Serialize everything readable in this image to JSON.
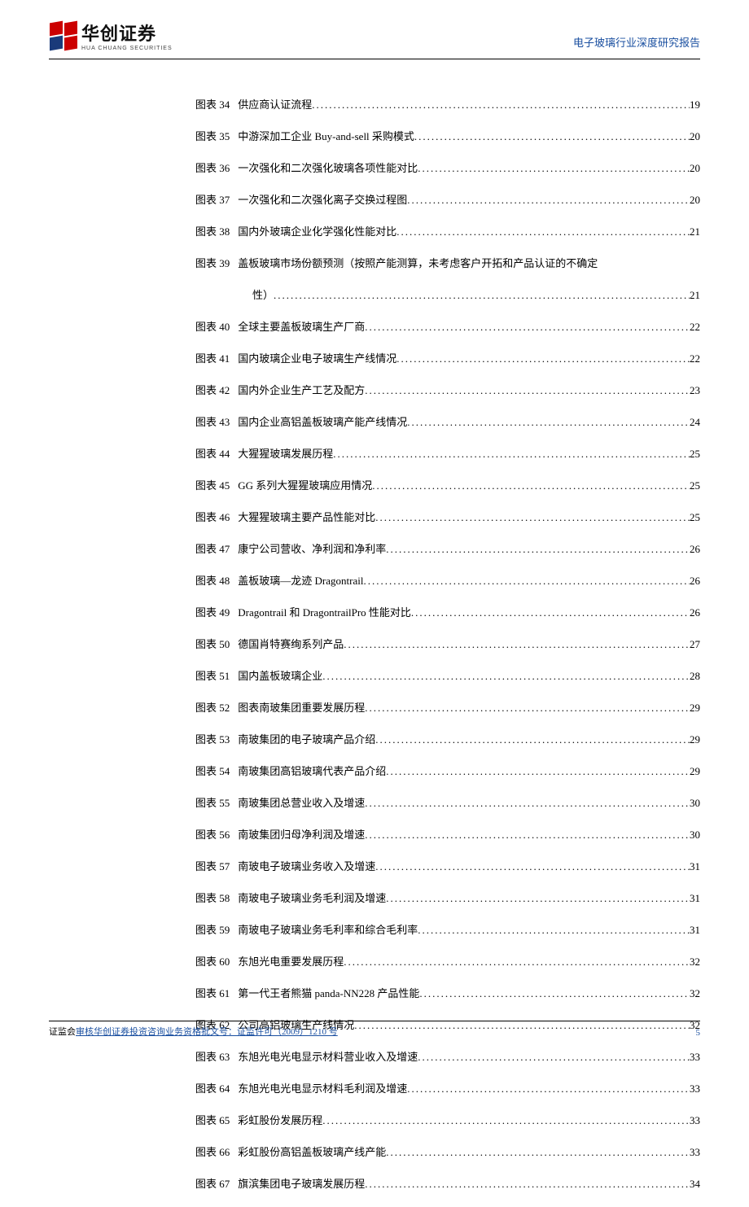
{
  "header": {
    "logo_cn": "华创证券",
    "logo_en": "HUA CHUANG SECURITIES",
    "report_title": "电子玻璃行业深度研究报告"
  },
  "toc": {
    "label_prefix": "图表",
    "entries": [
      {
        "num": "34",
        "title": "供应商认证流程",
        "page": "19"
      },
      {
        "num": "35",
        "title": "中游深加工企业 Buy-and-sell 采购模式",
        "page": "20"
      },
      {
        "num": "36",
        "title": "一次强化和二次强化玻璃各项性能对比",
        "page": "20"
      },
      {
        "num": "37",
        "title": "一次强化和二次强化离子交换过程图",
        "page": "20"
      },
      {
        "num": "38",
        "title": "国内外玻璃企业化学强化性能对比",
        "page": "21"
      },
      {
        "num": "39",
        "title": "盖板玻璃市场份额预测（按照产能测算，未考虑客户开拓和产品认证的不确定",
        "wrap": "性）",
        "page": "21"
      },
      {
        "num": "40",
        "title": "全球主要盖板玻璃生产厂商",
        "page": "22"
      },
      {
        "num": "41",
        "title": "国内玻璃企业电子玻璃生产线情况",
        "page": "22"
      },
      {
        "num": "42",
        "title": "国内外企业生产工艺及配方",
        "page": "23"
      },
      {
        "num": "43",
        "title": "国内企业高铝盖板玻璃产能产线情况",
        "page": "24"
      },
      {
        "num": "44",
        "title": "大猩猩玻璃发展历程",
        "page": "25"
      },
      {
        "num": "45",
        "title": "GG 系列大猩猩玻璃应用情况",
        "page": "25"
      },
      {
        "num": "46",
        "title": "大猩猩玻璃主要产品性能对比",
        "page": "25"
      },
      {
        "num": "47",
        "title": "康宁公司营收、净利润和净利率",
        "page": "26"
      },
      {
        "num": "48",
        "title": "盖板玻璃—龙迹 Dragontrail",
        "page": "26"
      },
      {
        "num": "49",
        "title": "Dragontrail 和 DragontrailPro 性能对比",
        "page": "26"
      },
      {
        "num": "50",
        "title": "德国肖特赛绚系列产品",
        "page": "27"
      },
      {
        "num": "51",
        "title": "国内盖板玻璃企业",
        "page": "28"
      },
      {
        "num": "52",
        "title": "图表南玻集团重要发展历程",
        "page": "29"
      },
      {
        "num": "53",
        "title": "南玻集团的电子玻璃产品介绍",
        "page": "29"
      },
      {
        "num": "54",
        "title": "南玻集团高铝玻璃代表产品介绍",
        "page": "29"
      },
      {
        "num": "55",
        "title": "南玻集团总营业收入及增速",
        "page": "30"
      },
      {
        "num": "56",
        "title": "南玻集团归母净利润及增速",
        "page": "30"
      },
      {
        "num": "57",
        "title": "南玻电子玻璃业务收入及增速",
        "page": "31"
      },
      {
        "num": "58",
        "title": "南玻电子玻璃业务毛利润及增速",
        "page": "31"
      },
      {
        "num": "59",
        "title": "南玻电子玻璃业务毛利率和综合毛利率",
        "page": "31"
      },
      {
        "num": "60",
        "title": "东旭光电重要发展历程",
        "page": "32"
      },
      {
        "num": "61",
        "title": "第一代王者熊猫 panda-NN228 产品性能",
        "page": "32"
      },
      {
        "num": "62",
        "title": "公司高铝玻璃生产线情况",
        "page": "32"
      },
      {
        "num": "63",
        "title": "东旭光电光电显示材料营业收入及增速",
        "page": "33"
      },
      {
        "num": "64",
        "title": "东旭光电光电显示材料毛利润及增速",
        "page": "33"
      },
      {
        "num": "65",
        "title": "彩虹股份发展历程",
        "page": "33"
      },
      {
        "num": "66",
        "title": "彩虹股份高铝盖板玻璃产线产能",
        "page": "33"
      },
      {
        "num": "67",
        "title": "旗滨集团电子玻璃发展历程",
        "page": "34"
      }
    ]
  },
  "footer": {
    "prefix": "证监会",
    "link_text": "审核华创证券投资咨询业务资格批文号：证监许可（2009）1210 号",
    "page_number": "5"
  }
}
